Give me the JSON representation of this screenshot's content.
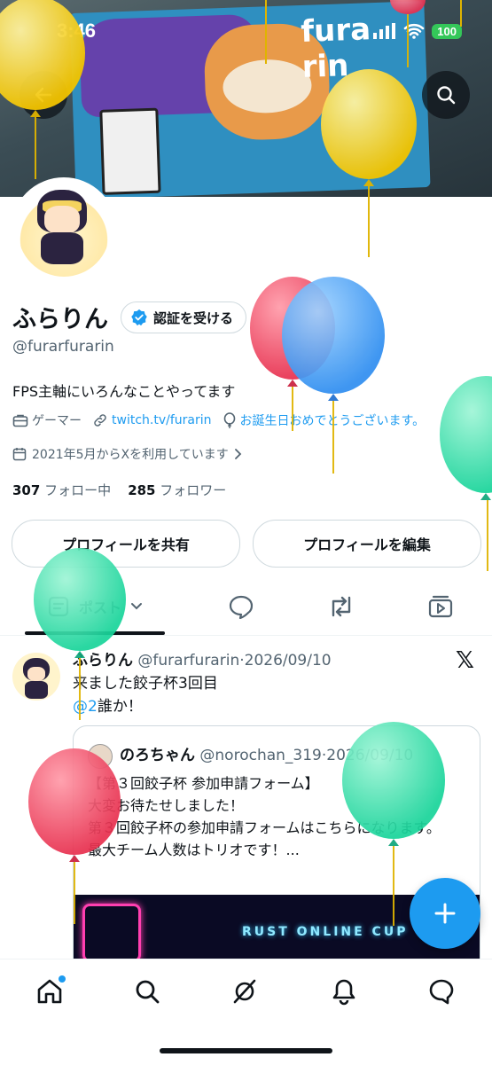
{
  "status": {
    "time": "3:46",
    "battery": "100"
  },
  "banner": {
    "sign_text": "fura rin"
  },
  "profile": {
    "name": "ふらりん",
    "verify_label": "認証を受ける",
    "handle": "@furarfurarin",
    "bio": "FPS主軸にいろんなことやってます",
    "category": "ゲーマー",
    "link": "twitch.tv/furarin",
    "birthday": "お誕生日おめでとうございます。",
    "joined": "2021年5月からXを利用しています",
    "following_count": "307",
    "following_label": "フォロー中",
    "followers_count": "285",
    "followers_label": "フォロワー",
    "share_button": "プロフィールを共有",
    "edit_button": "プロフィールを編集"
  },
  "tabs": {
    "posts": "ポスト"
  },
  "tweet": {
    "name": "ふらりん",
    "handle": "@furarfurarin",
    "date": "2026/09/10",
    "line1": "来ました餃子杯3回目",
    "mention": "@2",
    "line2_rest": "誰か！",
    "quote": {
      "name": "のろちゃん",
      "handle": "@norochan_319",
      "date": "2026/09/10",
      "lines": [
        "【第３回餃子杯 参加申請フォーム】",
        "大変お待たせしました！",
        "第３回餃子杯の参加申請フォームはこちらになります。",
        "最大チーム人数はトリオです！..."
      ],
      "image_text": "RUST ONLINE CUP"
    }
  },
  "colors": {
    "accent": "#1d9bf0",
    "text": "#0f1419",
    "muted": "#536471"
  }
}
